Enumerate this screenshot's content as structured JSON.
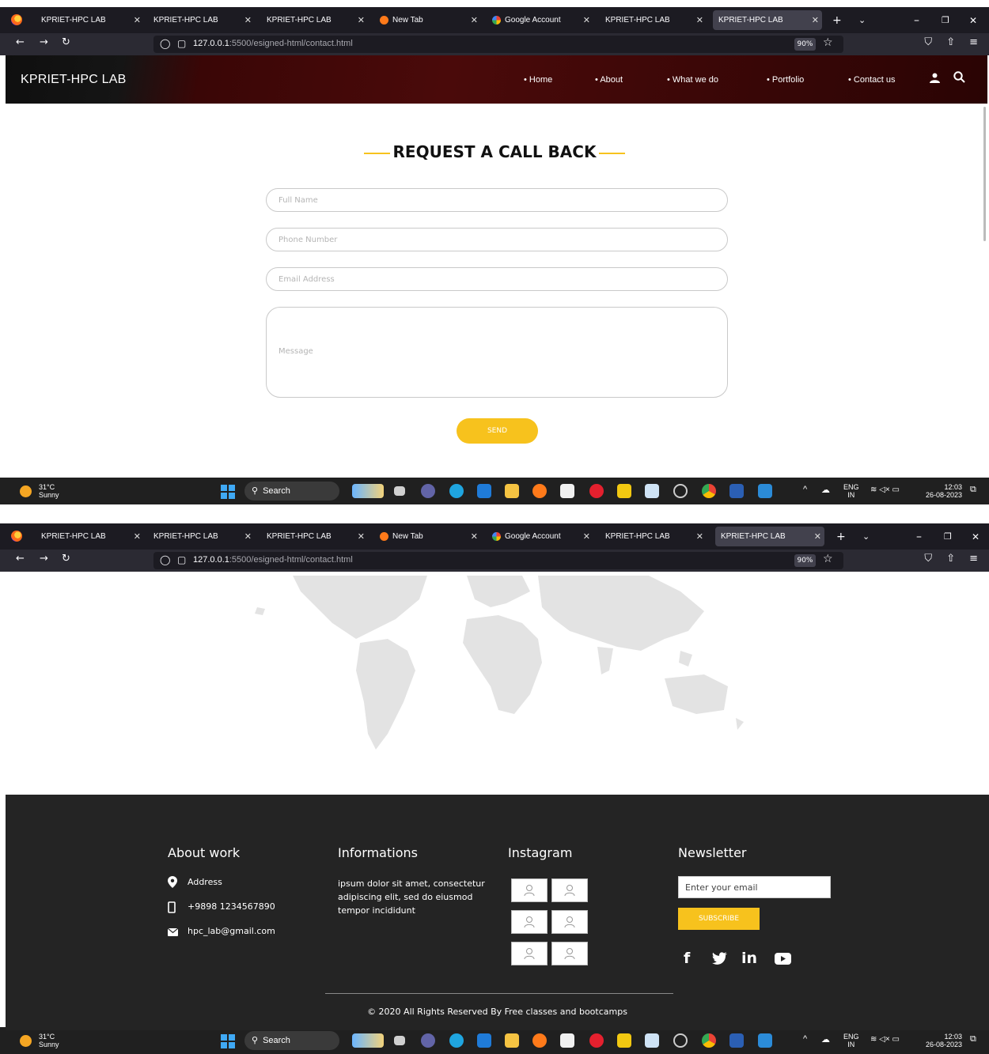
{
  "browser": {
    "tabs": [
      "KPRIET-HPC LAB",
      "KPRIET-HPC LAB",
      "KPRIET-HPC LAB",
      "New Tab",
      "Google Account",
      "KPRIET-HPC LAB",
      "KPRIET-HPC LAB"
    ],
    "active_tab_index": 6,
    "url_host": "127.0.0.1",
    "url_rest": ":5500/esigned-html/contact.html",
    "zoom": "90%"
  },
  "site": {
    "brand": "KPRIET-HPC LAB",
    "menu": [
      "Home",
      "About",
      "What we do",
      "Portfolio",
      "Contact us"
    ]
  },
  "form": {
    "title": "REQUEST A CALL BACK",
    "full_name_placeholder": "Full Name",
    "phone_placeholder": "Phone Number",
    "email_placeholder": "Email Address",
    "message_placeholder": "Message",
    "send_label": "SEND"
  },
  "taskbar": {
    "temp": "31°C",
    "condition": "Sunny",
    "search_label": "Search",
    "lang_top": "ENG",
    "lang_bottom": "IN",
    "time": "12:03",
    "date": "26-08-2023"
  },
  "footer": {
    "about_heading": "About work",
    "address": "Address",
    "phone": "+9898 1234567890",
    "email": "hpc_lab@gmail.com",
    "info_heading": "Informations",
    "info_text": "ipsum dolor sit amet, consectetur adipiscing elit, sed do eiusmod tempor incididunt",
    "instagram_heading": "Instagram",
    "newsletter_heading": "Newsletter",
    "newsletter_placeholder": "Enter your email",
    "subscribe_label": "SUBSCRIBE",
    "social": [
      "f",
      "t",
      "in",
      "yt"
    ],
    "copyright": "© 2020 All Rights Reserved By Free classes and bootcamps"
  },
  "colors": {
    "accent": "#f7c21d",
    "footer_bg": "#242424",
    "header_red": "#4a0a0a",
    "browser_dark": "#1c1b22"
  }
}
